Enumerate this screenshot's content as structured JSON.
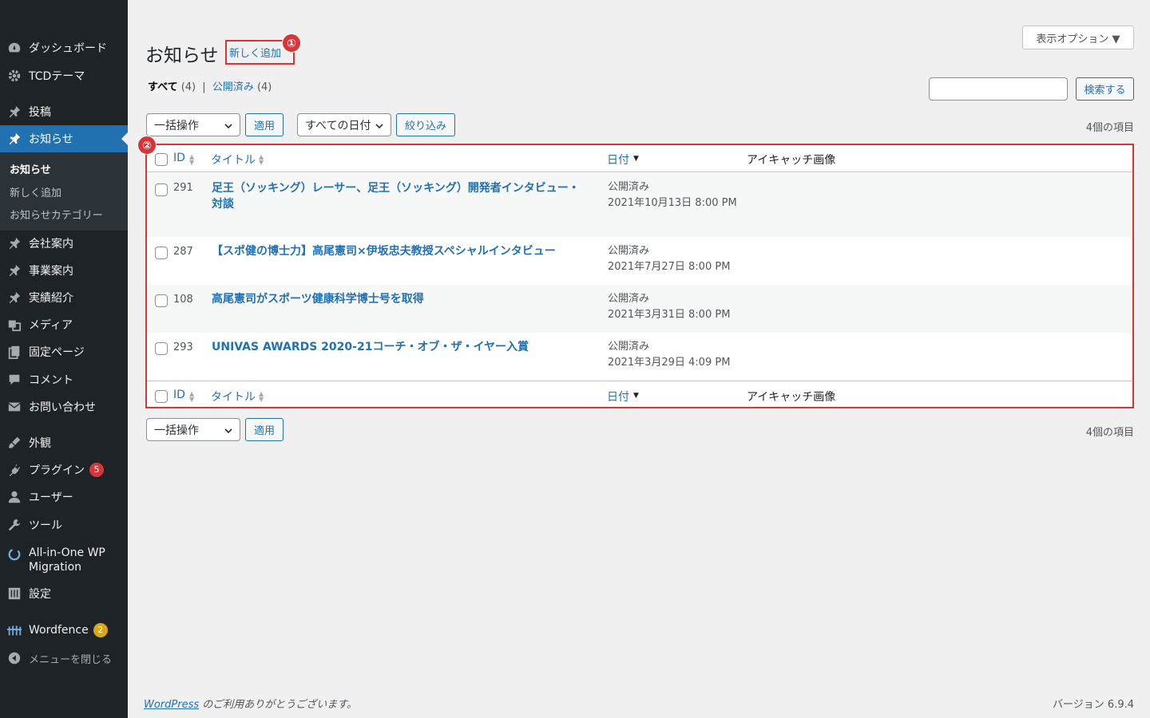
{
  "sidebar": {
    "items": [
      {
        "label": "ダッシュボード",
        "icon": "dashboard-icon"
      },
      {
        "label": "TCDテーマ",
        "icon": "gear-icon"
      },
      {
        "label": "投稿",
        "icon": "pin-icon"
      },
      {
        "label": "お知らせ",
        "icon": "pin-icon"
      },
      {
        "label": "会社案内",
        "icon": "pin-icon"
      },
      {
        "label": "事業案内",
        "icon": "pin-icon"
      },
      {
        "label": "実績紹介",
        "icon": "pin-icon"
      },
      {
        "label": "メディア",
        "icon": "media-icon"
      },
      {
        "label": "固定ページ",
        "icon": "pages-icon"
      },
      {
        "label": "コメント",
        "icon": "comment-icon"
      },
      {
        "label": "お問い合わせ",
        "icon": "mail-icon"
      },
      {
        "label": "外観",
        "icon": "brush-icon"
      },
      {
        "label": "プラグイン",
        "icon": "plugin-icon",
        "badge": "5"
      },
      {
        "label": "ユーザー",
        "icon": "user-icon"
      },
      {
        "label": "ツール",
        "icon": "wrench-icon"
      },
      {
        "label": "All-in-One WP Migration",
        "icon": "migration-icon"
      },
      {
        "label": "設定",
        "icon": "settings-icon"
      },
      {
        "label": "Wordfence",
        "icon": "wordfence-icon",
        "badge": "2"
      },
      {
        "label": "メニューを閉じる",
        "icon": "collapse-icon"
      }
    ],
    "submenu": [
      "お知らせ",
      "新しく追加",
      "お知らせカテゴリー"
    ]
  },
  "header": {
    "title": "お知らせ",
    "add_new": "新しく追加",
    "screen_options": "表示オプション ▼",
    "annotation_1": "①",
    "annotation_2": "②"
  },
  "filters": {
    "all_label": "すべて",
    "all_count": "(4)",
    "sep": "|",
    "published_label": "公開済み",
    "published_count": "(4)",
    "search_button": "検索する",
    "bulk_action": "一括操作",
    "apply": "適用",
    "all_dates": "すべての日付",
    "filter_button": "絞り込み",
    "items_count": "4個の項目"
  },
  "table": {
    "columns": {
      "id": "ID",
      "title": "タイトル",
      "date": "日付",
      "featured": "アイキャッチ画像"
    },
    "rows": [
      {
        "id": "291",
        "title": "足王（ソッキング）レーサー、足王（ソッキング）開発者インタビュー・対談",
        "status": "公開済み",
        "date": "2021年10月13日 8:00 PM"
      },
      {
        "id": "287",
        "title": "【スポ健の博士力】高尾憲司×伊坂忠夫教授スペシャルインタビュー",
        "status": "公開済み",
        "date": "2021年7月27日 8:00 PM"
      },
      {
        "id": "108",
        "title": "高尾憲司がスポーツ健康科学博士号を取得",
        "status": "公開済み",
        "date": "2021年3月31日 8:00 PM"
      },
      {
        "id": "293",
        "title": "UNIVAS AWARDS 2020-21コーチ・オブ・ザ・イヤー入賞",
        "status": "公開済み",
        "date": "2021年3月29日 4:09 PM"
      }
    ]
  },
  "footer": {
    "wp_link": "WordPress",
    "thanks": " のご利用ありがとうございます。",
    "version": "バージョン 6.9.4"
  },
  "colors": {
    "accent": "#2271b1",
    "sidebar_bg": "#1d2327",
    "highlight": "#d63638",
    "badge_plugins": "#d63638",
    "badge_wordfence": "#dba617"
  }
}
